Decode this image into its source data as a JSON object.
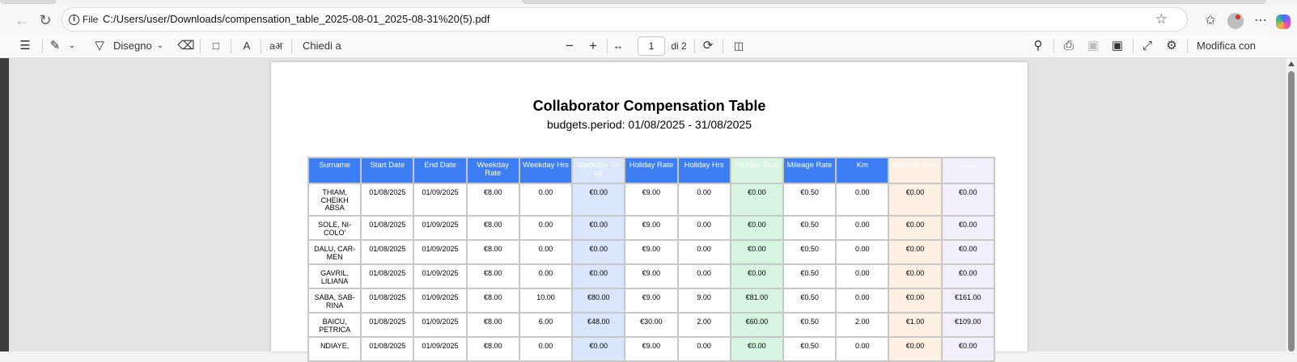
{
  "browser": {
    "address_scheme_label": "File",
    "url": "C:/Users/user/Downloads/compensation_table_2025-08-01_2025-08-31%20(5).pdf",
    "icons": [
      "back-arrow-icon",
      "refresh-icon",
      "info-icon",
      "favorite-star-icon",
      "favorites-icon",
      "profile-avatar-icon",
      "more-icon",
      "copilot-icon"
    ]
  },
  "pdf_toolbar": {
    "draw_label": "Disegno",
    "ask_copilot_label": "Chiedi a Copilot",
    "page_number": "1",
    "page_total": "di 2",
    "edit_acrobat_label": "Modifica con Acrobat"
  },
  "document": {
    "title": "Collaborator Compensation Table",
    "subtitle": "budgets.period: 01/08/2025 - 31/08/2025",
    "columns": [
      "Surname",
      "Start Date",
      "End Date",
      "Weekday Rate",
      "Weekday Hrs",
      "Weekday To-tal",
      "Holiday Rate",
      "Holiday Hrs",
      "Holiday Total",
      "Mileage Rate",
      "Km",
      "Mileage Total",
      "Total"
    ],
    "rows": [
      {
        "surname": "THIAM, CHEIKH ABSA",
        "start": "01/08/2025",
        "end": "01/09/2025",
        "wd_rate": "€8.00",
        "wd_hrs": "0.00",
        "wd_total": "€0.00",
        "hol_rate": "€9.00",
        "hol_hrs": "0.00",
        "hol_total": "€0.00",
        "mil_rate": "€0.50",
        "km": "0.00",
        "mil_total": "€0.00",
        "total": "€0.00"
      },
      {
        "surname": "SOLE, NI-COLO'",
        "start": "01/08/2025",
        "end": "01/09/2025",
        "wd_rate": "€8.00",
        "wd_hrs": "0.00",
        "wd_total": "€0.00",
        "hol_rate": "€9.00",
        "hol_hrs": "0.00",
        "hol_total": "€0.00",
        "mil_rate": "€0.50",
        "km": "0.00",
        "mil_total": "€0.00",
        "total": "€0.00"
      },
      {
        "surname": "DALU, CAR-MEN",
        "start": "01/08/2025",
        "end": "01/09/2025",
        "wd_rate": "€8.00",
        "wd_hrs": "0.00",
        "wd_total": "€0.00",
        "hol_rate": "€9.00",
        "hol_hrs": "0.00",
        "hol_total": "€0.00",
        "mil_rate": "€0.50",
        "km": "0.00",
        "mil_total": "€0.00",
        "total": "€0.00"
      },
      {
        "surname": "GAVRIL, LILIANA",
        "start": "01/08/2025",
        "end": "01/09/2025",
        "wd_rate": "€8.00",
        "wd_hrs": "0.00",
        "wd_total": "€0.00",
        "hol_rate": "€9.00",
        "hol_hrs": "0.00",
        "hol_total": "€0.00",
        "mil_rate": "€0.50",
        "km": "0.00",
        "mil_total": "€0.00",
        "total": "€0.00"
      },
      {
        "surname": "SABA, SAB-RINA",
        "start": "01/08/2025",
        "end": "01/09/2025",
        "wd_rate": "€8.00",
        "wd_hrs": "10.00",
        "wd_total": "€80.00",
        "hol_rate": "€9.00",
        "hol_hrs": "9.00",
        "hol_total": "€81.00",
        "mil_rate": "€0.50",
        "km": "0.00",
        "mil_total": "€0.00",
        "total": "€161.00"
      },
      {
        "surname": "BAICU, PETRICA",
        "start": "01/08/2025",
        "end": "01/09/2025",
        "wd_rate": "€8.00",
        "wd_hrs": "6.00",
        "wd_total": "€48.00",
        "hol_rate": "€30.00",
        "hol_hrs": "2.00",
        "hol_total": "€60.00",
        "mil_rate": "€0.50",
        "km": "2.00",
        "mil_total": "€1.00",
        "total": "€109.00"
      },
      {
        "surname": "NDIAYE,",
        "start": "01/08/2025",
        "end": "01/09/2025",
        "wd_rate": "€8.00",
        "wd_hrs": "0.00",
        "wd_total": "€0.00",
        "hol_rate": "€9.00",
        "hol_hrs": "0.00",
        "hol_total": "€0.00",
        "mil_rate": "€0.50",
        "km": "0.00",
        "mil_total": "€0.00",
        "total": "€0.00"
      }
    ]
  }
}
